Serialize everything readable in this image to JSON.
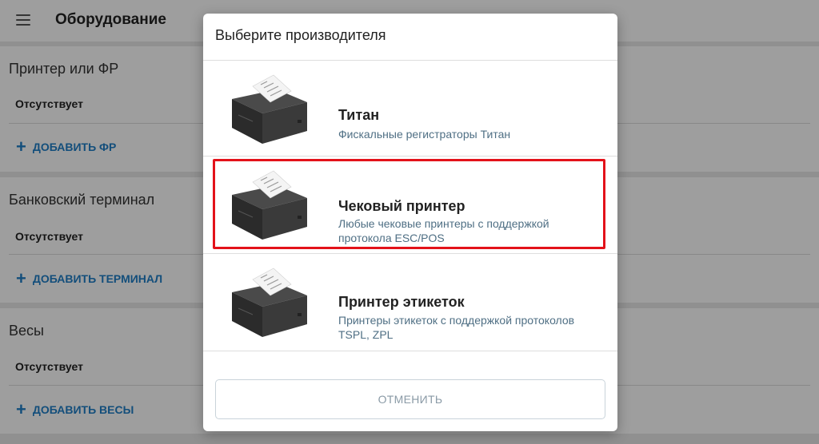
{
  "app": {
    "title": "Оборудование",
    "sections": [
      {
        "title": "Принтер или ФР",
        "status": "Отсутствует",
        "add_label": "ДОБАВИТЬ ФР"
      },
      {
        "title": "Банковский терминал",
        "status": "Отсутствует",
        "add_label": "ДОБАВИТЬ ТЕРМИНАЛ"
      },
      {
        "title": "Весы",
        "status": "Отсутствует",
        "add_label": "ДОБАВИТЬ ВЕСЫ"
      }
    ]
  },
  "dialog": {
    "title": "Выберите производителя",
    "options": [
      {
        "name": "Титан",
        "description": "Фискальные регистраторы Титан",
        "icon": "receipt-printer-icon"
      },
      {
        "name": "Чековый принтер",
        "description": "Любые чековые принтеры с поддержкой протокола ESC/POS",
        "icon": "receipt-printer-icon",
        "highlighted": true
      },
      {
        "name": "Принтер этикеток",
        "description": "Принтеры этикеток с поддержкой протоколов TSPL, ZPL",
        "icon": "receipt-printer-icon"
      }
    ],
    "cancel_label": "ОТМЕНИТЬ"
  },
  "colors": {
    "accent": "#1f7fc7",
    "highlight_border": "#e3121a",
    "description": "#4f6f84"
  }
}
